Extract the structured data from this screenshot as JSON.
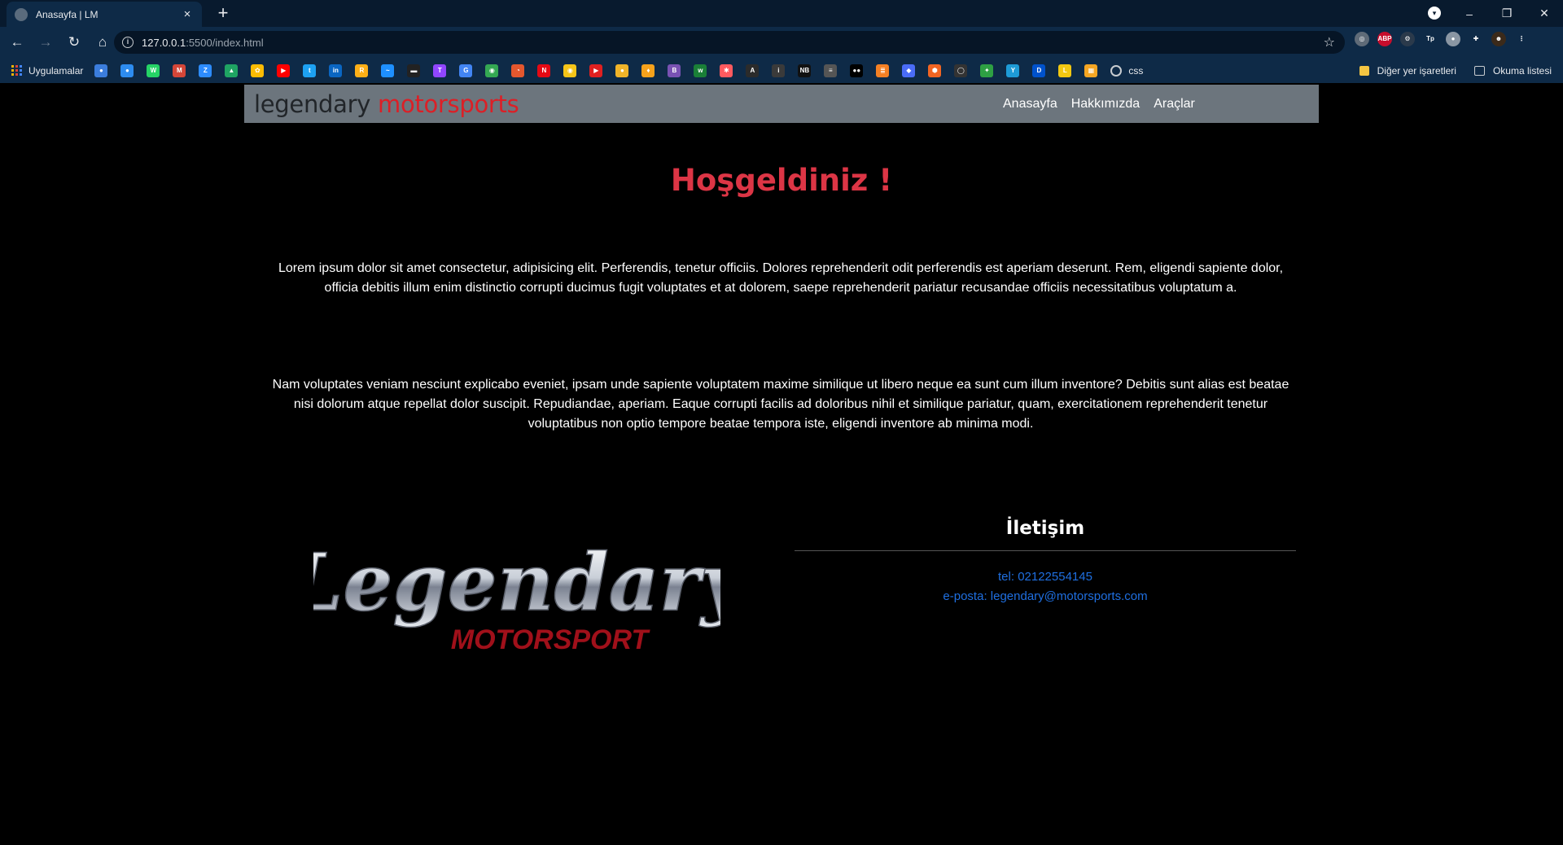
{
  "browser": {
    "tab_title": "Anasayfa | LM",
    "tab_close": "×",
    "new_tab": "+",
    "url_host": "127.0.0.1",
    "url_path": ":5500/index.html",
    "window_controls": {
      "minimize": "–",
      "restore": "❐",
      "close": "✕"
    },
    "bookmarks_apps_label": "Uygulamalar",
    "bookmark_css_label": "css",
    "other_bookmarks_label": "Diğer yer işaretleri",
    "reading_list_label": "Okuma listesi",
    "bookmark_icons": [
      {
        "name": "bookmark-1-icon",
        "color": "#3b7ddd",
        "glyph": "●"
      },
      {
        "name": "bookmark-2-icon",
        "color": "#2d8cf0",
        "glyph": "●"
      },
      {
        "name": "whatsapp-icon",
        "color": "#25d366",
        "glyph": "W"
      },
      {
        "name": "gmail-icon",
        "color": "#d44638",
        "glyph": "M"
      },
      {
        "name": "zoom-icon",
        "color": "#2d8cff",
        "glyph": "Z"
      },
      {
        "name": "google-drive-icon",
        "color": "#1fa463",
        "glyph": "▲"
      },
      {
        "name": "google-photos-icon",
        "color": "#fbbc04",
        "glyph": "✿"
      },
      {
        "name": "youtube-icon",
        "color": "#ff0000",
        "glyph": "▶"
      },
      {
        "name": "twitter-icon",
        "color": "#1da1f2",
        "glyph": "t"
      },
      {
        "name": "linkedin-icon",
        "color": "#0a66c2",
        "glyph": "in"
      },
      {
        "name": "rockstar-icon",
        "color": "#fcaf17",
        "glyph": "R"
      },
      {
        "name": "bookmark-wave-icon",
        "color": "#1e90ff",
        "glyph": "~"
      },
      {
        "name": "bookmark-dark-icon",
        "color": "#222222",
        "glyph": "▬"
      },
      {
        "name": "twitch-icon",
        "color": "#9146ff",
        "glyph": "T"
      },
      {
        "name": "google-translate-icon",
        "color": "#4285f4",
        "glyph": "G"
      },
      {
        "name": "google-maps-icon",
        "color": "#34a853",
        "glyph": "◉"
      },
      {
        "name": "bookmark-orange-icon",
        "color": "#e4572e",
        "glyph": "◔"
      },
      {
        "name": "netflix-icon",
        "color": "#e50914",
        "glyph": "N"
      },
      {
        "name": "bookmark-yellow-icon",
        "color": "#f5c518",
        "glyph": "◉"
      },
      {
        "name": "bookmark-red-play-icon",
        "color": "#e02020",
        "glyph": "▶"
      },
      {
        "name": "bookmark-circle-icon",
        "color": "#f0b429",
        "glyph": "●"
      },
      {
        "name": "bookmark-bulb-icon",
        "color": "#f7a21b",
        "glyph": "♦"
      },
      {
        "name": "bootstrap-icon",
        "color": "#7952b3",
        "glyph": "B"
      },
      {
        "name": "bookmark-w-icon",
        "color": "#1a7f37",
        "glyph": "w"
      },
      {
        "name": "bookmark-asterisk-icon",
        "color": "#ff5a5f",
        "glyph": "✱"
      },
      {
        "name": "bookmark-a-icon",
        "color": "#2b2b2b",
        "glyph": "A"
      },
      {
        "name": "bookmark-i-icon",
        "color": "#3a3a3a",
        "glyph": "i"
      },
      {
        "name": "bookmark-nb-icon",
        "color": "#111111",
        "glyph": "NB"
      },
      {
        "name": "stackoverflow-icon",
        "color": "#555555",
        "glyph": "≡"
      },
      {
        "name": "medium-icon",
        "color": "#000000",
        "glyph": "●●"
      },
      {
        "name": "bookmark-stack-icon",
        "color": "#f48024",
        "glyph": "≣"
      },
      {
        "name": "bookmark-diamond-icon",
        "color": "#4a6cf7",
        "glyph": "◆"
      },
      {
        "name": "bookmark-hex-icon",
        "color": "#f26522",
        "glyph": "⬢"
      },
      {
        "name": "github-icon",
        "color": "#333333",
        "glyph": "◯"
      },
      {
        "name": "bookmark-multi-icon",
        "color": "#2ea043",
        "glyph": "✦"
      },
      {
        "name": "bookmark-y-icon",
        "color": "#1e9bd7",
        "glyph": "Y"
      },
      {
        "name": "bookmark-d-icon",
        "color": "#0052cc",
        "glyph": "D"
      },
      {
        "name": "bookmark-l-icon",
        "color": "#f2c811",
        "glyph": "L"
      },
      {
        "name": "bookmark-grid-icon",
        "color": "#f5a623",
        "glyph": "▦"
      }
    ],
    "extensions": [
      {
        "name": "extension-circle-icon",
        "color": "#5f6b78",
        "glyph": "◎"
      },
      {
        "name": "adblock-plus-icon",
        "color": "#c70d2c",
        "glyph": "ABP"
      },
      {
        "name": "extension-gear-icon",
        "color": "#2b3a4b",
        "glyph": "⚙"
      },
      {
        "name": "extension-tp-icon",
        "color": "#0e2a47",
        "glyph": "Tp"
      },
      {
        "name": "extension-dot-icon",
        "color": "#8a96a3",
        "glyph": "●"
      },
      {
        "name": "extensions-puzzle-icon",
        "color": "#0e2a47",
        "glyph": "✚"
      },
      {
        "name": "profile-avatar-icon",
        "color": "#3b2a1a",
        "glyph": "☻"
      },
      {
        "name": "browser-menu-icon",
        "color": "#0e2a47",
        "glyph": "⋮"
      }
    ]
  },
  "site": {
    "brand_part1": "legendary",
    "brand_part2": "motorsports",
    "nav": [
      "Anasayfa",
      "Hakkımızda",
      "Araçlar"
    ],
    "welcome": "Hoşgeldiniz !",
    "paragraph1": "Lorem ipsum dolor sit amet consectetur, adipisicing elit. Perferendis, tenetur officiis. Dolores reprehenderit odit perferendis est aperiam deserunt. Rem, eligendi sapiente dolor, officia debitis illum enim distinctio corrupti ducimus fugit voluptates et at dolorem, saepe reprehenderit pariatur recusandae officiis necessitatibus voluptatum a.",
    "paragraph2": "Nam voluptates veniam nesciunt explicabo eveniet, ipsam unde sapiente voluptatem maxime similique ut libero neque ea sunt cum illum inventore? Debitis sunt alias est beatae nisi dolorum atque repellat dolor suscipit. Repudiandae, aperiam. Eaque corrupti facilis ad doloribus nihil et similique pariatur, quam, exercitationem reprehenderit tenetur voluptatibus non optio tempore beatae tempora iste, eligendi inventore ab minima modi.",
    "logo_text_main": "Legendary",
    "logo_text_sub": "MOTORSPORT",
    "contact_title": "İletişim",
    "contact_phone": "tel: 02122554145",
    "contact_email": "e-posta: legendary@motorsports.com",
    "colors": {
      "accent_red": "#dc3545",
      "brand_red": "#dc1f26",
      "link_blue": "#1f6fe0",
      "navbar_gray": "#6c757d"
    }
  }
}
